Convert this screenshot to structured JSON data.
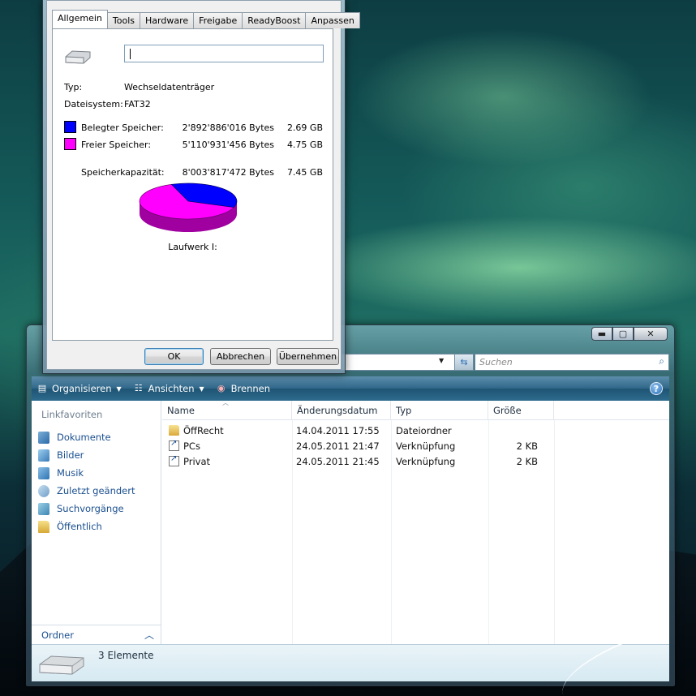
{
  "explorer": {
    "search_placeholder": "Suchen",
    "toolbar": {
      "organize": "Organisieren",
      "views": "Ansichten",
      "burn": "Brennen"
    },
    "nav": {
      "header": "Linkfavoriten",
      "items": [
        {
          "label": "Dokumente",
          "icon": "documents-icon"
        },
        {
          "label": "Bilder",
          "icon": "pictures-icon"
        },
        {
          "label": "Musik",
          "icon": "music-icon"
        },
        {
          "label": "Zuletzt geändert",
          "icon": "recent-icon"
        },
        {
          "label": "Suchvorgänge",
          "icon": "searches-icon"
        },
        {
          "label": "Öffentlich",
          "icon": "public-folder-icon"
        }
      ],
      "folders_label": "Ordner"
    },
    "columns": [
      "Name",
      "Änderungsdatum",
      "Typ",
      "Größe"
    ],
    "files": [
      {
        "name": "ÖffRecht",
        "date": "14.04.2011 17:55",
        "type": "Dateiordner",
        "size": "",
        "icon": "folder-icon"
      },
      {
        "name": "PCs",
        "date": "24.05.2011 21:47",
        "type": "Verknüpfung",
        "size": "2 KB",
        "icon": "shortcut-icon"
      },
      {
        "name": "Privat",
        "date": "24.05.2011 21:45",
        "type": "Verknüpfung",
        "size": "2 KB",
        "icon": "shortcut-icon"
      }
    ],
    "details": {
      "count": "3 Elemente"
    }
  },
  "props": {
    "tabs": [
      "Allgemein",
      "Tools",
      "Hardware",
      "Freigabe",
      "ReadyBoost",
      "Anpassen"
    ],
    "active_tab": "Allgemein",
    "name_value": "",
    "type_label": "Typ:",
    "type_value": "Wechseldatenträger",
    "fs_label": "Dateisystem:",
    "fs_value": "FAT32",
    "used_label": "Belegter Speicher:",
    "used_bytes": "2'892'886'016 Bytes",
    "used_gb": "2.69 GB",
    "free_label": "Freier Speicher:",
    "free_bytes": "5'110'931'456 Bytes",
    "free_gb": "4.75 GB",
    "cap_label": "Speicherkapazität:",
    "cap_bytes": "8'003'817'472 Bytes",
    "cap_gb": "7.45 GB",
    "drive_label": "Laufwerk I:",
    "used_color": "#0000ff",
    "free_color": "#ff00ff",
    "used_fraction": 0.3614,
    "buttons": {
      "ok": "OK",
      "cancel": "Abbrechen",
      "apply": "Übernehmen"
    }
  }
}
